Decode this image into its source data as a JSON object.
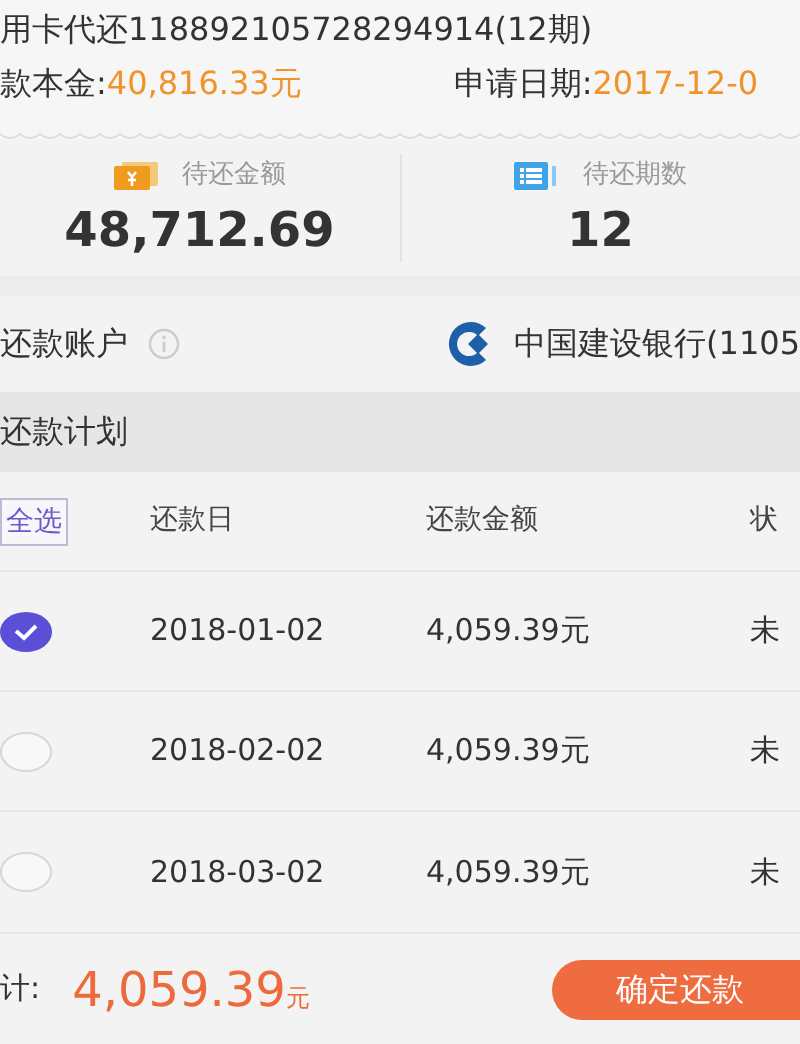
{
  "header": {
    "title": "用卡代还118892105728294914(12期)",
    "principal_label": "款本金:",
    "principal_value": "40,816.33元",
    "date_label": "申请日期:",
    "date_value": "2017-12-0"
  },
  "stats": [
    {
      "kind": "amount",
      "label": "待还金额",
      "value": "48,712.69"
    },
    {
      "kind": "periods",
      "label": "待还期数",
      "value": "12"
    }
  ],
  "account": {
    "label": "还款账户",
    "bank": "中国建设银行(1105"
  },
  "plan": {
    "title": "还款计划",
    "select_all": "全选",
    "columns": [
      "还款日",
      "还款金额",
      "状"
    ]
  },
  "rows": [
    {
      "selected": true,
      "date": "2018-01-02",
      "amount": "4,059.39元",
      "status": "未"
    },
    {
      "selected": false,
      "date": "2018-02-02",
      "amount": "4,059.39元",
      "status": "未"
    },
    {
      "selected": false,
      "date": "2018-03-02",
      "amount": "4,059.39元",
      "status": "未"
    }
  ],
  "footer": {
    "total_label": "计:",
    "total_value": "4,059.39",
    "currency": "元",
    "button": "确定还款"
  }
}
